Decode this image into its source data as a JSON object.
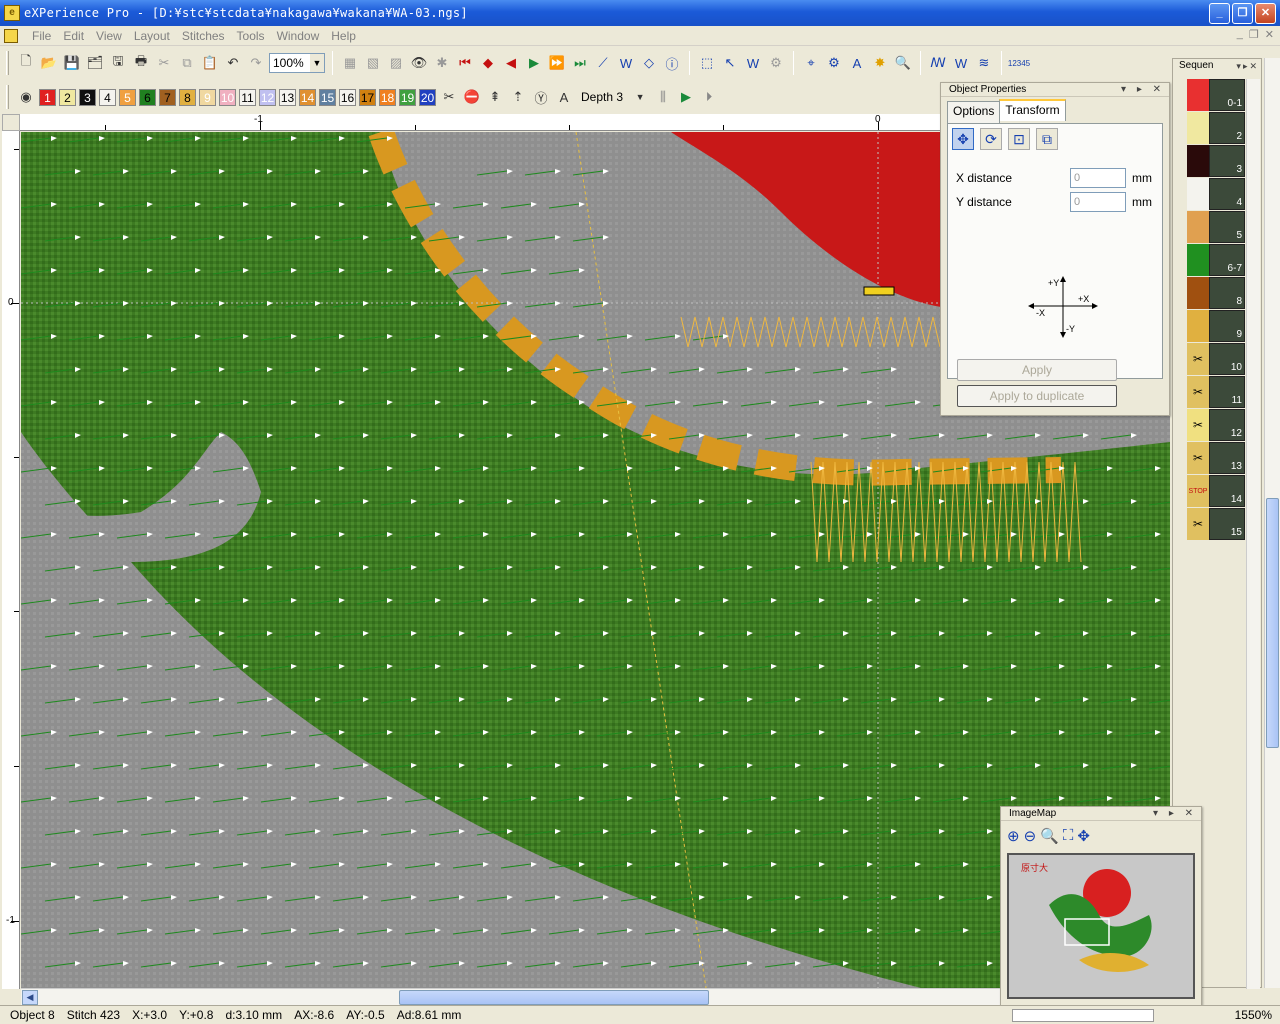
{
  "window": {
    "title": "eXPerience Pro - [D:¥stc¥stcdata¥nakagawa¥wakana¥WA-03.ngs]",
    "min_label": "_",
    "max_label": "❐",
    "close_label": "✕"
  },
  "menu": {
    "items": [
      "File",
      "Edit",
      "View",
      "Layout",
      "Stitches",
      "Tools",
      "Window",
      "Help"
    ],
    "mdi": {
      "min": "_",
      "restore": "❐",
      "close": "✕"
    }
  },
  "toolbar": {
    "zoom": "100%",
    "depth": "Depth 3",
    "colors": [
      {
        "num": "1",
        "bg": "#e02020",
        "fg": "#ffffff"
      },
      {
        "num": "2",
        "bg": "#f0e8a0",
        "fg": "#000000"
      },
      {
        "num": "3",
        "bg": "#101010",
        "fg": "#ffffff"
      },
      {
        "num": "4",
        "bg": "#f4f3ee",
        "fg": "#000000"
      },
      {
        "num": "5",
        "bg": "#f0a040",
        "fg": "#ffffff"
      },
      {
        "num": "6",
        "bg": "#208020",
        "fg": "#000000"
      },
      {
        "num": "7",
        "bg": "#a06020",
        "fg": "#000000"
      },
      {
        "num": "8",
        "bg": "#e0b040",
        "fg": "#000000"
      },
      {
        "num": "9",
        "bg": "#f0d8a0",
        "fg": "#ffffff"
      },
      {
        "num": "10",
        "bg": "#f0b0c0",
        "fg": "#ffffff"
      },
      {
        "num": "11",
        "bg": "#f4f3ee",
        "fg": "#000000"
      },
      {
        "num": "12",
        "bg": "#c0c0f0",
        "fg": "#ffffff"
      },
      {
        "num": "13",
        "bg": "#f4f3ee",
        "fg": "#000000"
      },
      {
        "num": "14",
        "bg": "#e09030",
        "fg": "#ffffff"
      },
      {
        "num": "15",
        "bg": "#6080a0",
        "fg": "#ffffff"
      },
      {
        "num": "16",
        "bg": "#f4f3ee",
        "fg": "#000000"
      },
      {
        "num": "17",
        "bg": "#d08010",
        "fg": "#000000"
      },
      {
        "num": "18",
        "bg": "#f08020",
        "fg": "#ffffff"
      },
      {
        "num": "19",
        "bg": "#40a040",
        "fg": "#ffffff"
      },
      {
        "num": "20",
        "bg": "#2040c0",
        "fg": "#ffffff"
      }
    ],
    "stop_label": "STOP"
  },
  "rulers": {
    "top": [
      {
        "label": "-1"
      },
      {
        "label": "0"
      }
    ],
    "left": [
      {
        "label": "0"
      },
      {
        "label": "-1"
      }
    ]
  },
  "object_properties": {
    "title": "Object Properties",
    "tabs": [
      "Options",
      "Transform"
    ],
    "x_label": "X distance",
    "x_value": "0",
    "y_label": "Y distance",
    "y_value": "0",
    "unit": "mm",
    "axis": {
      "py": "+Y",
      "px": "+X",
      "nx": "-X",
      "ny": "-Y"
    },
    "apply": "Apply",
    "apply_dup": "Apply to duplicate"
  },
  "sequence": {
    "title": "Sequen",
    "items": [
      {
        "label": "0-1",
        "color": "#e83030",
        "icon": ""
      },
      {
        "label": "2",
        "color": "#f0e8a0",
        "icon": ""
      },
      {
        "label": "3",
        "color": "#2a0a0a",
        "icon": ""
      },
      {
        "label": "4",
        "color": "#f4f3ee",
        "icon": ""
      },
      {
        "label": "5",
        "color": "#e0a050",
        "icon": ""
      },
      {
        "label": "6-7",
        "color": "#209020",
        "icon": ""
      },
      {
        "label": "8",
        "color": "#a05010",
        "icon": ""
      },
      {
        "label": "9",
        "color": "#e0b040",
        "icon": ""
      },
      {
        "label": "10",
        "color": "#e0c060",
        "icon": "✂"
      },
      {
        "label": "11",
        "color": "#e0c060",
        "icon": "✂"
      },
      {
        "label": "12",
        "color": "#f0e080",
        "icon": "✂"
      },
      {
        "label": "13",
        "color": "#e0c060",
        "icon": "✂"
      },
      {
        "label": "14",
        "color": "#e0c060",
        "icon": "STOP"
      },
      {
        "label": "15",
        "color": "#e0c060",
        "icon": "✂"
      }
    ]
  },
  "imagemap": {
    "title": "ImageMap",
    "thumb_label": "原寸大"
  },
  "status": {
    "object": "Object 8",
    "stitch": "Stitch 423",
    "x": "X:+3.0",
    "y": "Y:+0.8",
    "d": "d:3.10 mm",
    "ax": "AX:-8.6",
    "ay": "AY:-0.5",
    "ad": "Ad:8.61 mm",
    "zoom": "1550%"
  },
  "icons": {
    "new": "new-file-icon",
    "open": "open-folder-icon",
    "save": "save-icon",
    "print": "printer-icon",
    "cut": "scissors-icon",
    "copy": "copy-icon",
    "paste": "paste-icon",
    "undo": "undo-icon",
    "redo": "redo-icon",
    "info": "info-icon",
    "select": "select-arrow-icon",
    "zoom": "magnifier-icon"
  },
  "colors": {
    "fabric_green": "#3d7a22",
    "fabric_grey": "#929292",
    "sun_red": "#c81818",
    "gold": "#d89820",
    "titlebar": "#1b5ad8"
  }
}
